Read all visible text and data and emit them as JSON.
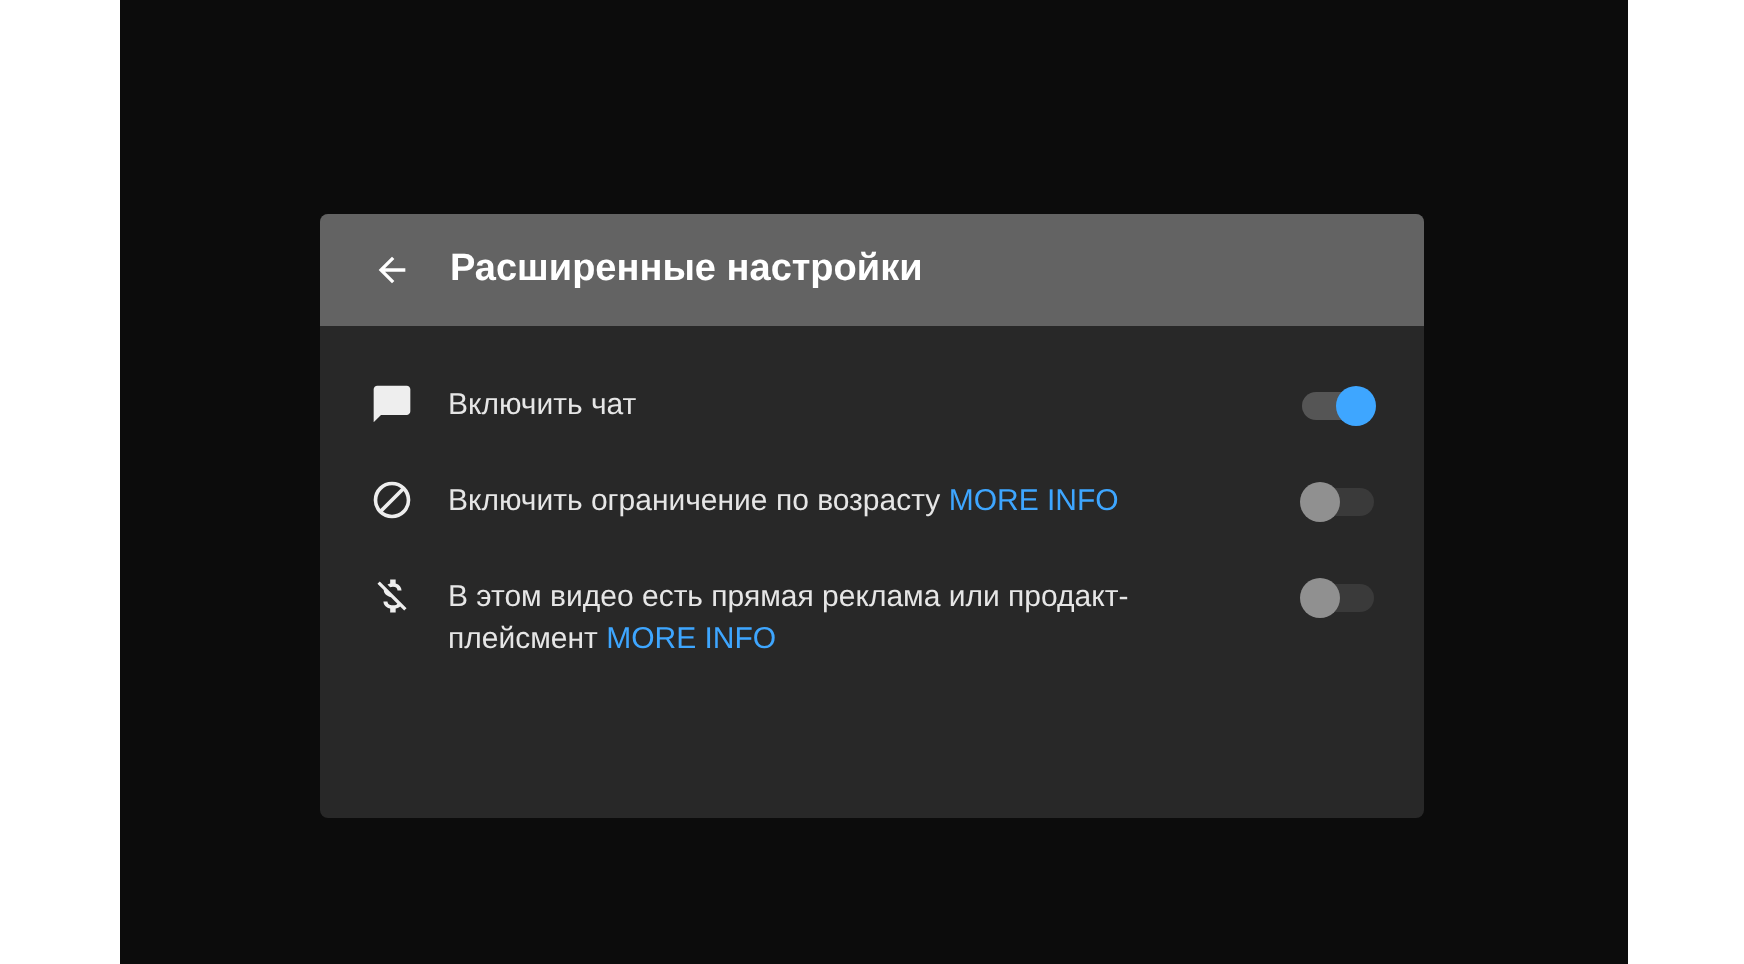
{
  "dialog": {
    "title": "Расширенные настройки"
  },
  "settings": [
    {
      "label": "Включить чат",
      "on": true
    },
    {
      "label": "Включить ограничение по возрасту",
      "link": "MORE INFO",
      "on": false
    },
    {
      "label": "В этом видео есть прямая реклама или продакт-плейсмент",
      "link": "MORE INFO",
      "on": false
    }
  ]
}
